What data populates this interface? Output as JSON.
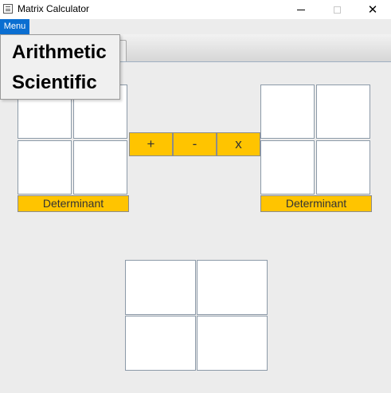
{
  "window": {
    "title": "Matrix Calculator",
    "icon": "calculator-icon",
    "controls": {
      "minimize": "minimize-icon",
      "maximize": "maximize-icon",
      "close": "close-icon"
    }
  },
  "menubar": {
    "menu_label": "Menu"
  },
  "popup_menu": {
    "items": [
      "Arithmetic",
      "Scientific"
    ]
  },
  "matrix_a": {
    "cells": [
      "",
      "",
      "",
      ""
    ],
    "determinant_label": "Determinant"
  },
  "matrix_b": {
    "cells": [
      "",
      "",
      "",
      ""
    ],
    "determinant_label": "Determinant"
  },
  "operations": {
    "add": "+",
    "subtract": "-",
    "multiply": "x"
  },
  "result_matrix": {
    "cells": [
      "",
      "",
      "",
      ""
    ]
  },
  "colors": {
    "accent_button": "#ffc400",
    "menu_highlight": "#0a6ed1",
    "background": "#ececec"
  }
}
